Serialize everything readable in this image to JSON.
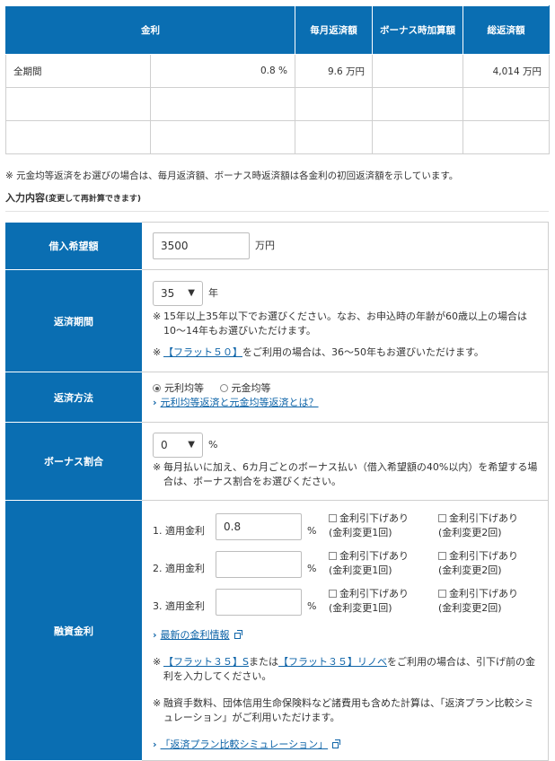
{
  "results": {
    "headers": [
      "金利",
      "",
      "毎月返済額",
      "ボーナス時加算額",
      "総返済額"
    ],
    "rows": [
      {
        "period": "全期間",
        "rate": "0.8 %",
        "monthly": "9.6 万円",
        "bonus": "",
        "total": "4,014 万円"
      },
      {
        "period": "",
        "rate": "",
        "monthly": "",
        "bonus": "",
        "total": ""
      },
      {
        "period": "",
        "rate": "",
        "monthly": "",
        "bonus": "",
        "total": ""
      }
    ]
  },
  "note_top": "※ 元金均等返済をお選びの場合は、毎月返済額、ボーナス時返済額は各金利の初回返済額を示しています。",
  "input_heading": "入力内容",
  "input_heading_sub": "(変更して再計算できます)",
  "form": {
    "loan": {
      "label": "借入希望額",
      "value": "3500",
      "unit": "万円"
    },
    "period": {
      "label": "返済期間",
      "value": "35",
      "unit": "年",
      "note1": "15年以上35年以下でお選びください。なお、お申込時の年齢が60歳以上の場合は10～14年もお選びいただけます。",
      "note2_link": "【フラット５０】",
      "note2_rest": "をご利用の場合は、36～50年もお選びいただけます。"
    },
    "method": {
      "label": "返済方法",
      "option1": "元利均等",
      "option2": "元金均等",
      "link": "元利均等返済と元金均等返済とは？"
    },
    "bonus": {
      "label": "ボーナス割合",
      "value": "0",
      "unit": "%",
      "note": "毎月払いに加え、6カ月ごとのボーナス払い（借入希望額の40%以内）を希望する場合は、ボーナス割合をお選びください。"
    },
    "rate": {
      "label": "融資金利",
      "rows": [
        {
          "label": "1. 適用金利",
          "value": "0.8"
        },
        {
          "label": "2. 適用金利",
          "value": ""
        },
        {
          "label": "3. 適用金利",
          "value": ""
        }
      ],
      "unit": "%",
      "opt1_a": "金利引下げあり",
      "opt1_b": "(金利変更1回)",
      "opt2_a": "金利引下げあり",
      "opt2_b": "(金利変更2回)",
      "latest_link": "最新の金利情報",
      "note1_link1": "【フラット３５】S",
      "note1_mid": "または",
      "note1_link2": "【フラット３５】リノベ",
      "note1_rest": "をご利用の場合は、引下げ前の金利を入力してください。",
      "note2": "融資手数料、団体信用生命保険料など諸費用も含めた計算は、「返済プラン比較シミュレーション」がご利用いただけます。",
      "sim_link": "「返済プラン比較シミュレーション」"
    }
  },
  "note_mark": "※"
}
